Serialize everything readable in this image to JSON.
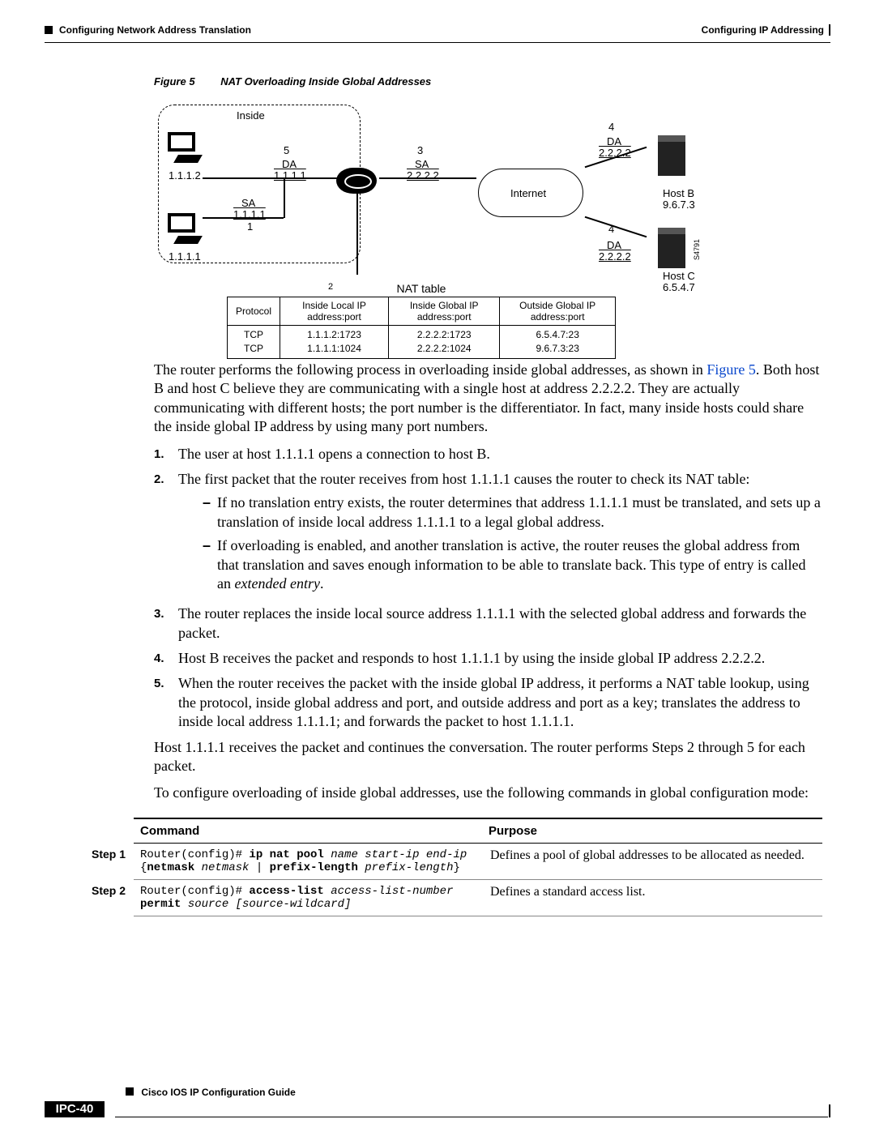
{
  "header": {
    "left": "Configuring Network Address Translation",
    "right": "Configuring IP Addressing"
  },
  "figure": {
    "label": "Figure 5",
    "title": "NAT Overloading Inside Global Addresses",
    "inside_label": "Inside",
    "host_a_top": "1.1.1.2",
    "host_a_bot": "1.1.1.1",
    "annot5": "5",
    "da5": "DA",
    "da5_ip": "1.1.1.1",
    "annot1": "1",
    "sa_label": "SA",
    "sa_ip": "1.1.1.1",
    "annot3": "3",
    "sa3_label": "SA",
    "sa3_ip": "2.2.2.2",
    "internet": "Internet",
    "annot4_top": "4",
    "da_top_label": "DA",
    "da_top_ip": "2.2.2.2",
    "annot4_bot": "4",
    "da_bot_label": "DA",
    "da_bot_ip": "2.2.2.2",
    "hostb": "Host B",
    "hostb_ip": "9.6.7.3",
    "hostc": "Host C",
    "hostc_ip": "6.5.4.7",
    "side_code": "S4791",
    "nat_caption_num": "2",
    "nat_caption": "NAT table",
    "nat_headers": [
      "Protocol",
      "Inside Local IP address:port",
      "Inside Global IP address:port",
      "Outside Global IP address:port"
    ],
    "nat_rows": [
      [
        "TCP",
        "1.1.1.2:1723",
        "2.2.2.2:1723",
        "6.5.4.7:23"
      ],
      [
        "TCP",
        "1.1.1.1:1024",
        "2.2.2.2:1024",
        "9.6.7.3:23"
      ]
    ]
  },
  "para1_a": "The router performs the following process in overloading inside global addresses, as shown in ",
  "para1_link": "Figure 5",
  "para1_b": ". Both host B and host C believe they are communicating with a single host at address 2.2.2.2. They are actually communicating with different hosts; the port number is the differentiator. In fact, many inside hosts could share the inside global IP address by using many port numbers.",
  "steps": {
    "s1": "The user at host 1.1.1.1 opens a connection to host B.",
    "s2": "The first packet that the router receives from host 1.1.1.1 causes the router to check its NAT table:",
    "s2a": "If no translation entry exists, the router determines that address 1.1.1.1 must be translated, and sets up a translation of inside local address 1.1.1.1 to a legal global address.",
    "s2b_a": "If overloading is enabled, and another translation is active, the router reuses the global address from that translation and saves enough information to be able to translate back. This type of entry is called an ",
    "s2b_em": "extended entry",
    "s3": "The router replaces the inside local source address 1.1.1.1 with the selected global address and forwards the packet.",
    "s4": "Host B receives the packet and responds to host 1.1.1.1 by using the inside global IP address 2.2.2.2.",
    "s5": "When the router receives the packet with the inside global IP address, it performs a NAT table lookup, using the protocol, inside global address and port, and outside address and port as a key; translates the address to inside local address 1.1.1.1; and forwards the packet to host 1.1.1.1."
  },
  "para2": "Host 1.1.1.1 receives the packet and continues the conversation. The router performs Steps 2 through 5 for each packet.",
  "para3": "To configure overloading of inside global addresses, use the following commands in global configuration mode:",
  "cmdtable": {
    "h_command": "Command",
    "h_purpose": "Purpose",
    "rows": [
      {
        "step": "Step 1",
        "cmd_prefix": "Router(config)# ",
        "cmd_bold1": "ip nat pool ",
        "cmd_it1": "name start-ip end-ip",
        "cmd_line2_open": "{",
        "cmd_bold2": "netmask ",
        "cmd_it2": "netmask",
        "cmd_mid": " | ",
        "cmd_bold3": "prefix-length ",
        "cmd_it3": "prefix-length",
        "cmd_close": "}",
        "purpose": "Defines a pool of global addresses to be allocated as needed."
      },
      {
        "step": "Step 2",
        "cmd_prefix": "Router(config)# ",
        "cmd_bold1": "access-list ",
        "cmd_it1": "access-list-number",
        "cmd_line2_bold": "permit ",
        "cmd_it2": "source ",
        "cmd_it3": "[source-wildcard]",
        "purpose": "Defines a standard access list."
      }
    ]
  },
  "footer": {
    "book": "Cisco IOS IP Configuration Guide",
    "page": "IPC-40"
  }
}
